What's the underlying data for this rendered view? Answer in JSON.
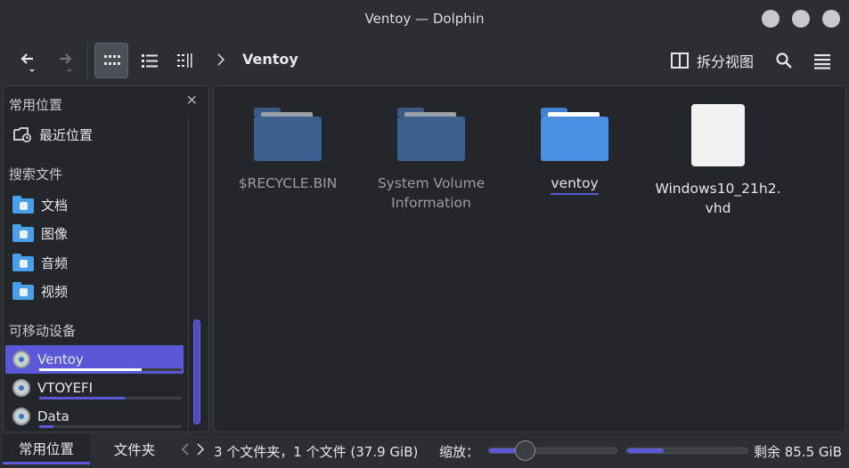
{
  "window": {
    "title": "Ventoy — Dolphin"
  },
  "toolbar": {
    "breadcrumb": "Ventoy",
    "split_label": "拆分视图"
  },
  "sidebar": {
    "head_places": "常用位置",
    "recent": "最近位置",
    "head_search": "搜索文件",
    "search_items": [
      "文档",
      "图像",
      "音频",
      "视频"
    ],
    "head_devices": "可移动设备",
    "devices": [
      {
        "label": "Ventoy",
        "usage": 0.72
      },
      {
        "label": "VTOYEFI",
        "usage": 0.6
      },
      {
        "label": "Data",
        "usage": 0.1
      }
    ]
  },
  "files": [
    {
      "name": "$RECYCLE.BIN",
      "kind": "folder-dim"
    },
    {
      "name": "System Volume\nInformation",
      "kind": "folder-dim"
    },
    {
      "name": "ventoy",
      "kind": "folder-bright"
    },
    {
      "name": "Windows10_21h2.\nvhd",
      "kind": "document"
    }
  ],
  "statusbar": {
    "tab_places": "常用位置",
    "tab_folders": "文件夹",
    "summary": "3 个文件夹，1 个文件 (37.9 GiB)",
    "zoom_label": "缩放：",
    "zoom_level": 0.28,
    "space_used_fraction": 0.3,
    "free_space": "剩余 85.5 GiB"
  },
  "colors": {
    "accent": "#5a58d6",
    "folder": "#4a90e2"
  }
}
